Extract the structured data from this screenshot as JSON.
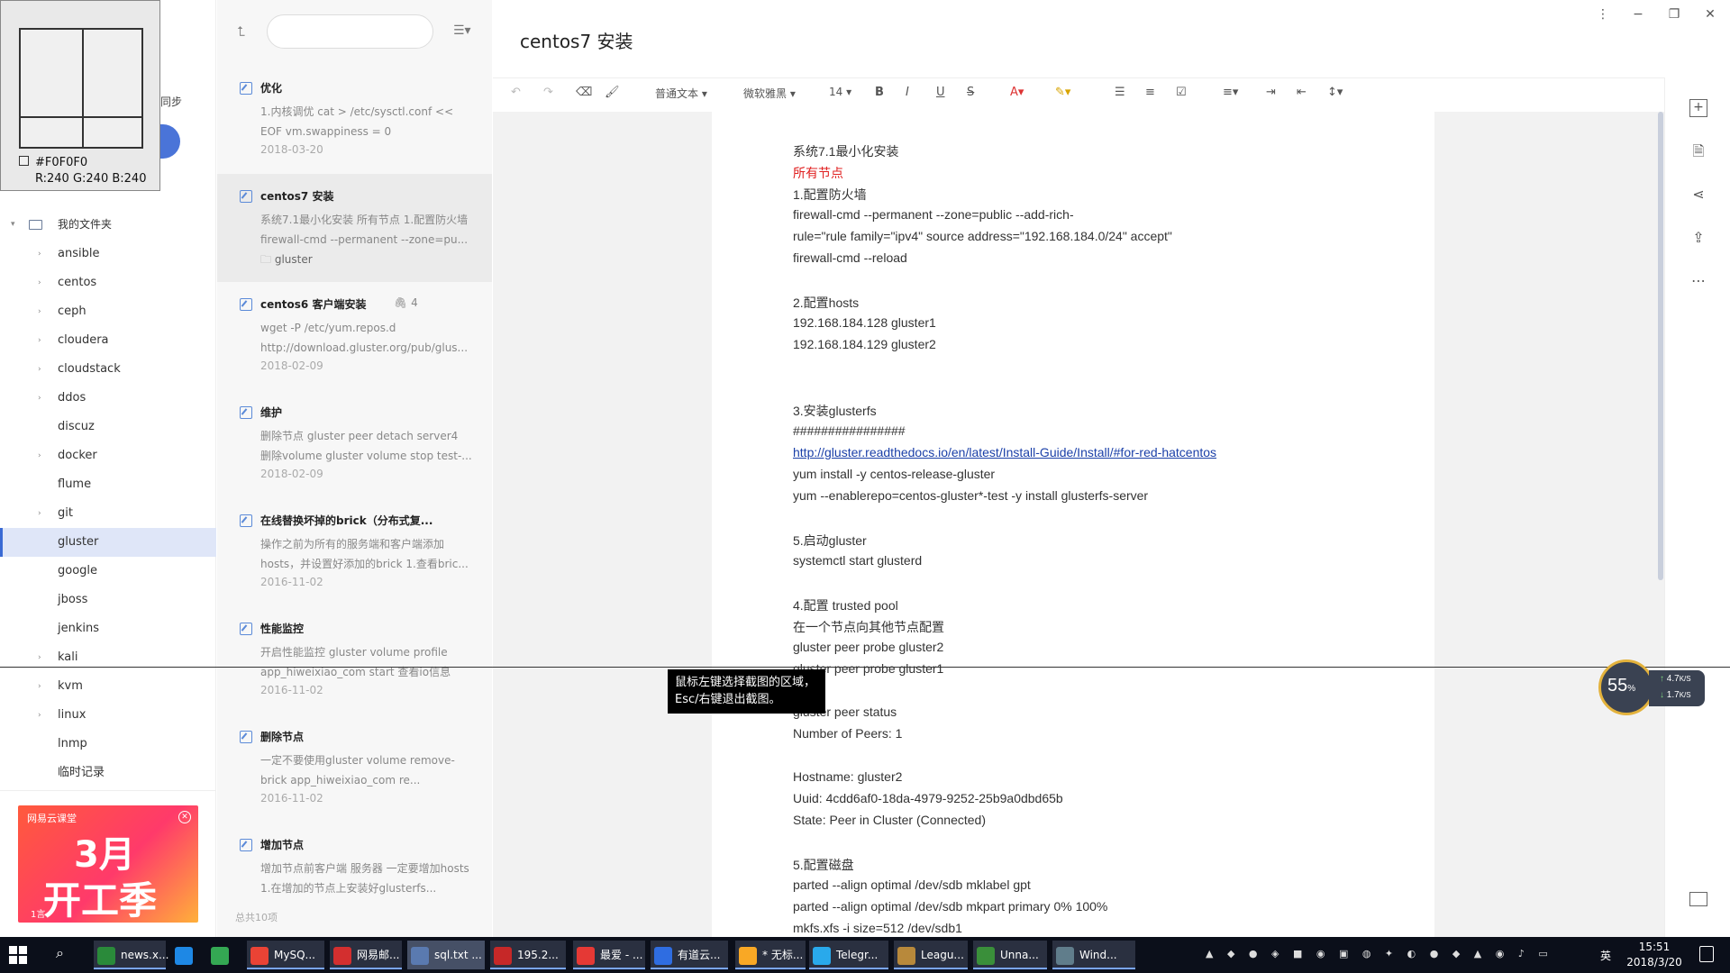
{
  "window": {
    "more_icon": "more-vertical-icon",
    "minimize": "−",
    "restore": "❐",
    "close": "✕"
  },
  "sidebar": {
    "sync_fragment": "同步",
    "root_label": "我的文件夹",
    "items": [
      {
        "label": "ansible",
        "arrow": true
      },
      {
        "label": "centos",
        "arrow": true
      },
      {
        "label": "ceph",
        "arrow": true
      },
      {
        "label": "cloudera",
        "arrow": true
      },
      {
        "label": "cloudstack",
        "arrow": true
      },
      {
        "label": "ddos",
        "arrow": true
      },
      {
        "label": "discuz",
        "arrow": false
      },
      {
        "label": "docker",
        "arrow": true
      },
      {
        "label": "flume",
        "arrow": false
      },
      {
        "label": "git",
        "arrow": true
      },
      {
        "label": "gluster",
        "arrow": false,
        "active": true
      },
      {
        "label": "google",
        "arrow": false
      },
      {
        "label": "jboss",
        "arrow": false
      },
      {
        "label": "jenkins",
        "arrow": false
      },
      {
        "label": "kali",
        "arrow": true
      },
      {
        "label": "kvm",
        "arrow": true
      },
      {
        "label": "linux",
        "arrow": true
      },
      {
        "label": "lnmp",
        "arrow": false
      },
      {
        "label": "临时记录",
        "arrow": false
      }
    ],
    "ad": {
      "brand": "网易云课堂",
      "headline1": "3月",
      "headline2": "开工季",
      "tag": "1言"
    }
  },
  "notelist": {
    "notes": [
      {
        "title": "优化",
        "summary": "1.内核调优 cat > /etc/sysctl.conf << EOF vm.swappiness = 0 net.core.rme...",
        "date": "2018-03-20"
      },
      {
        "title": "centos7 安装",
        "summary": "系统7.1最小化安装 所有节点 1.配置防火墙 firewall-cmd --permanent --zone=pu...",
        "folder": "gluster",
        "selected": true
      },
      {
        "title": "centos6 客户端安装",
        "summary": "wget -P /etc/yum.repos.d http://download.gluster.org/pub/glus...",
        "date": "2018-02-09",
        "attach": "4"
      },
      {
        "title": "维护",
        "summary": "删除节点 gluster peer detach server4 删除volume gluster volume stop test-...",
        "date": "2018-02-09"
      },
      {
        "title": "在线替换坏掉的brick（分布式复...",
        "summary": "操作之前为所有的服务端和客户端添加hosts，并设置好添加的brick 1.查看bric...",
        "date": "2016-11-02"
      },
      {
        "title": "性能监控",
        "summary": "开启性能监控 gluster volume profile app_hiweixiao_com start 查看io信息 gl...",
        "date": "2016-11-02"
      },
      {
        "title": "删除节点",
        "summary": "一定不要使用gluster volume remove-brick app_hiweixiao_com re...",
        "date": "2016-11-02"
      },
      {
        "title": "增加节点",
        "summary": "增加节点前客户端 服务器 一定要增加hosts 1.在增加的节点上安装好glusterfs...",
        "date": ""
      }
    ],
    "footer": "总共10项"
  },
  "editor": {
    "title": "centos7 安装",
    "toolbar": {
      "style": "普通文本",
      "font": "微软雅黑",
      "size": "14",
      "bold": "B",
      "italic": "I",
      "underline": "U",
      "strike": "S"
    },
    "lines": [
      {
        "t": "系统7.1最小化安装"
      },
      {
        "t": "所有节点",
        "red": true
      },
      {
        "t": "1.配置防火墙"
      },
      {
        "t": "firewall-cmd --permanent --zone=public --add-rich-"
      },
      {
        "t": "rule=\"rule family=\"ipv4\" source address=\"192.168.184.0/24\"  accept\""
      },
      {
        "t": "firewall-cmd --reload"
      },
      {
        "t": ""
      },
      {
        "t": "2.配置hosts"
      },
      {
        "t": "192.168.184.128   gluster1"
      },
      {
        "t": "192.168.184.129   gluster2"
      },
      {
        "t": ""
      },
      {
        "t": ""
      },
      {
        "t": "3.安装glusterfs"
      },
      {
        "t": "################"
      },
      {
        "t": "http://gluster.readthedocs.io/en/latest/Install-Guide/Install/#for-red-hatcentos",
        "link": true
      },
      {
        "t": "yum install -y centos-release-gluster"
      },
      {
        "t": "yum --enablerepo=centos-gluster*-test -y install glusterfs-server"
      },
      {
        "t": ""
      },
      {
        "t": "5.启动gluster"
      },
      {
        "t": "systemctl start glusterd"
      },
      {
        "t": ""
      },
      {
        "t": "4.配置 trusted pool"
      },
      {
        "t": "在一个节点向其他节点配置"
      },
      {
        "t": "gluster peer probe gluster2"
      },
      {
        "t": "gluster peer probe gluster1"
      },
      {
        "t": ""
      },
      {
        "t": "gluster peer status"
      },
      {
        "t": "Number of Peers: 1"
      },
      {
        "t": ""
      },
      {
        "t": "Hostname: gluster2"
      },
      {
        "t": "Uuid: 4cdd6af0-18da-4979-9252-25b9a0dbd65b"
      },
      {
        "t": "State: Peer in Cluster (Connected)"
      },
      {
        "t": ""
      },
      {
        "t": "5.配置磁盘"
      },
      {
        "t": "parted --align optimal /dev/sdb mklabel gpt"
      },
      {
        "t": "parted --align optimal /dev/sdb mkpart primary 0% 100%"
      },
      {
        "t": "mkfs.xfs -i size=512 /dev/sdb1"
      }
    ]
  },
  "overlay": {
    "color_hex": "#F0F0F0",
    "color_rgb": "R:240 G:240 B:240",
    "tip_line1": "鼠标左键选择截图的区域，",
    "tip_line2": "Esc/右键退出截图。",
    "net_percent": "55",
    "net_percent_sign": "%",
    "net_up": "4.7",
    "net_down": "1.7",
    "net_unit": "K/S"
  },
  "taskbar": {
    "items": [
      {
        "label": "news.x...",
        "color": "#2a8a3a"
      },
      {
        "label": "",
        "color": "#1e88e5"
      },
      {
        "label": "",
        "color": "#34a853"
      },
      {
        "label": "MySQ...",
        "color": "#ea4335"
      },
      {
        "label": "网易邮...",
        "color": "#d32f2f"
      },
      {
        "label": "sql.txt ...",
        "color": "#5a7ab0",
        "active": true
      },
      {
        "label": "195.2...",
        "color": "#c62828"
      },
      {
        "label": "最爱 - ...",
        "color": "#e53935"
      },
      {
        "label": "有道云...",
        "color": "#2f6de1"
      },
      {
        "label": "* 无标...",
        "color": "#f9a825"
      },
      {
        "label": "Telegr...",
        "color": "#29a9eb"
      },
      {
        "label": "Leagu...",
        "color": "#b8893b"
      },
      {
        "label": "Unna...",
        "color": "#3a8f3a"
      },
      {
        "label": "Wind...",
        "color": "#607d8b"
      }
    ],
    "time": "15:51",
    "date": "2018/3/20",
    "ime": "英"
  }
}
